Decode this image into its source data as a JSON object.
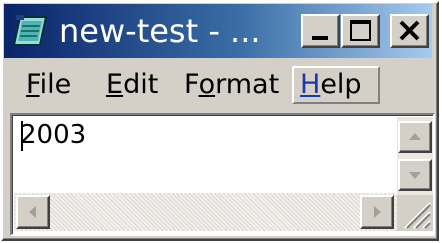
{
  "window": {
    "title": "new-test - ...",
    "app_icon": "notepad-icon",
    "controls": {
      "minimize": "minimize-icon",
      "maximize": "maximize-icon",
      "close": "close-icon"
    }
  },
  "menubar": {
    "items": [
      {
        "mnemonic": "F",
        "rest": "ile"
      },
      {
        "mnemonic": "E",
        "rest": "dit"
      },
      {
        "pre": "F",
        "mnemonic": "o",
        "rest": "rmat"
      },
      {
        "mnemonic": "H",
        "rest": "elp",
        "active": true
      }
    ]
  },
  "editor": {
    "content": "2003"
  },
  "scrollbars": {
    "vertical": {
      "up": "scroll-up-arrow-icon",
      "down": "scroll-down-arrow-icon"
    },
    "horizontal": {
      "left": "scroll-left-arrow-icon",
      "right": "scroll-right-arrow-icon"
    }
  },
  "colors": {
    "titlebar_start": "#0a246a",
    "titlebar_end": "#a6caf0",
    "face": "#d4d0c8",
    "help_highlight": "#1a3aa8"
  }
}
